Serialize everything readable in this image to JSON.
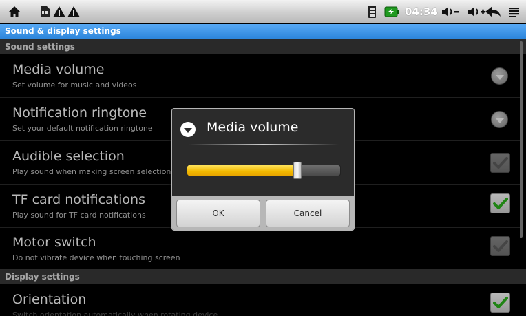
{
  "status_bar": {
    "icons": [
      "home-icon",
      "sd-card-icon",
      "warning-icon",
      "warning-icon",
      "sim-icon",
      "battery-icon",
      "volume-down-icon",
      "volume-up-icon",
      "back-icon",
      "menu-icon"
    ],
    "time": "04:34"
  },
  "title": "Sound & display settings",
  "sections": {
    "sound": "Sound settings",
    "display": "Display settings"
  },
  "rows": [
    {
      "title": "Media volume",
      "subtitle": "Set volume for music and videos",
      "control": "dropdown"
    },
    {
      "title": "Notification ringtone",
      "subtitle": "Set your default notification ringtone",
      "control": "dropdown"
    },
    {
      "title": "Audible selection",
      "subtitle": "Play sound when making screen selection",
      "control": "checkbox",
      "checked": true,
      "enabled": false
    },
    {
      "title": "TF card notifications",
      "subtitle": "Play sound for TF card notifications",
      "control": "checkbox",
      "checked": true,
      "enabled": true
    },
    {
      "title": "Motor switch",
      "subtitle": "Do not vibrate device when touching screen",
      "control": "checkbox",
      "checked": true,
      "enabled": false
    },
    {
      "title": "Orientation",
      "subtitle": "Switch orientation automatically when rotating device",
      "control": "checkbox",
      "checked": true,
      "enabled": true
    }
  ],
  "dialog": {
    "title": "Media volume",
    "volume_fraction": 0.72,
    "ok_label": "OK",
    "cancel_label": "Cancel"
  },
  "colors": {
    "title_bar": "#3a95e8",
    "slider_fill": "#f4b800",
    "check_green": "#2db81d",
    "check_gray": "#b0b0b0"
  }
}
